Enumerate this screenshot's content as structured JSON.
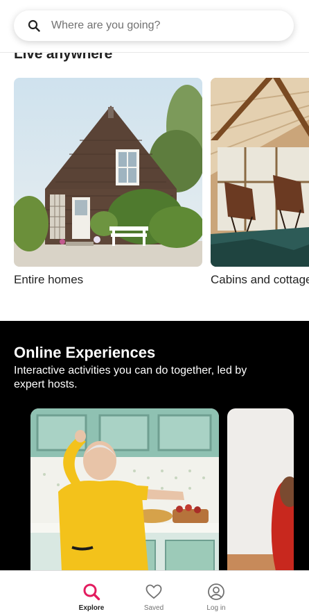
{
  "search": {
    "placeholder": "Where are you going?"
  },
  "live_anywhere": {
    "title": "Live anywhere",
    "cards": [
      {
        "label": "Entire homes"
      },
      {
        "label": "Cabins and cottages"
      }
    ]
  },
  "online_experiences": {
    "title": "Online Experiences",
    "subtitle": "Interactive activities you can do together, led by expert hosts."
  },
  "bottom_nav": {
    "items": [
      {
        "label": "Explore",
        "icon": "search-icon"
      },
      {
        "label": "Saved",
        "icon": "heart-icon"
      },
      {
        "label": "Log in",
        "icon": "user-circle-icon"
      }
    ]
  },
  "colors": {
    "brand": "#E31C5F",
    "text": "#222222",
    "muted": "#717171",
    "section_bg": "#000000"
  }
}
